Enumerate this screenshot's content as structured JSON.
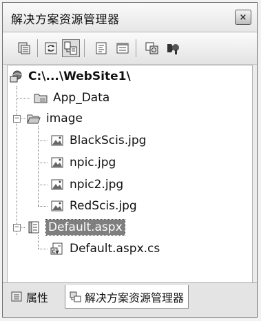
{
  "panel": {
    "title": "解决方案资源管理器",
    "close_glyph": "×"
  },
  "toolbar": {
    "buttons": [
      {
        "name": "properties-icon"
      },
      {
        "name": "refresh-icon"
      },
      {
        "name": "nest-related-files-icon"
      },
      {
        "name": "view-code-icon"
      },
      {
        "name": "view-designer-icon"
      },
      {
        "name": "copy-website-icon"
      },
      {
        "name": "asp-net-config-icon"
      }
    ]
  },
  "tree": {
    "root": "C:\\...\\WebSite1\\",
    "items": [
      {
        "label": "App_Data",
        "icon": "folder-icon"
      },
      {
        "label": "image",
        "icon": "folder-open-icon",
        "expanded": true
      },
      {
        "label": "BlackScis.jpg",
        "icon": "image-file-icon"
      },
      {
        "label": "npic.jpg",
        "icon": "image-file-icon"
      },
      {
        "label": "npic2.jpg",
        "icon": "image-file-icon"
      },
      {
        "label": "RedScis.jpg",
        "icon": "image-file-icon"
      },
      {
        "label": "Default.aspx",
        "icon": "aspx-page-icon",
        "expanded": true,
        "selected": true
      },
      {
        "label": "Default.aspx.cs",
        "icon": "csharp-file-icon"
      }
    ],
    "expander_minus": "−"
  },
  "tabs": [
    {
      "label": "属性",
      "icon": "properties-icon",
      "active": false
    },
    {
      "label": "解决方案资源管理器",
      "icon": "solution-explorer-icon",
      "active": true
    }
  ]
}
